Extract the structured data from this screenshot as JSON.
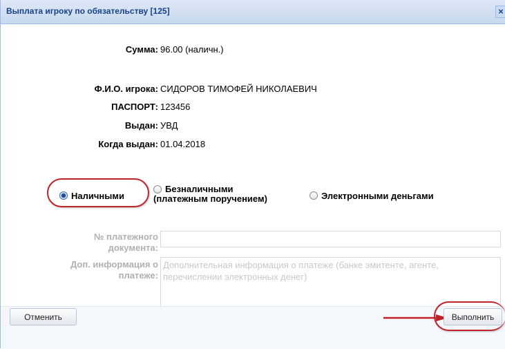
{
  "window": {
    "title": "Выплата игроку по обязательству [125]",
    "close_label": "×"
  },
  "info": [
    {
      "label": "Сумма:",
      "value": "96.00 (наличн.)"
    },
    {
      "label": "Ф.И.О. игрока:",
      "value": "СИДОРОВ ТИМОФЕЙ НИКОЛАЕВИЧ"
    },
    {
      "label": "ПАСПОРТ:",
      "value": "123456"
    },
    {
      "label": "Выдан:",
      "value": "УВД"
    },
    {
      "label": "Когда выдан:",
      "value": "01.04.2018"
    }
  ],
  "payment_method": {
    "options": [
      {
        "line1": "Наличными",
        "line2": "",
        "checked": true
      },
      {
        "line1": "Безналичными",
        "line2": "(платежным поручением)",
        "checked": false
      },
      {
        "line1": "Электронными деньгами",
        "line2": "",
        "checked": false
      }
    ]
  },
  "form": {
    "doc_number_label_1": "№ платежного",
    "doc_number_label_2": "документа:",
    "doc_number_value": "",
    "extra_info_label_1": "Доп. информация о",
    "extra_info_label_2": "платеже:",
    "extra_info_placeholder": "Дополнительная информация о платеже (банке эмитенте, агенте, перечислении электронных денег)"
  },
  "buttons": {
    "cancel": "Отменить",
    "execute": "Выполнить"
  },
  "colors": {
    "annotation": "#c0222a",
    "title_text": "#15428b"
  }
}
